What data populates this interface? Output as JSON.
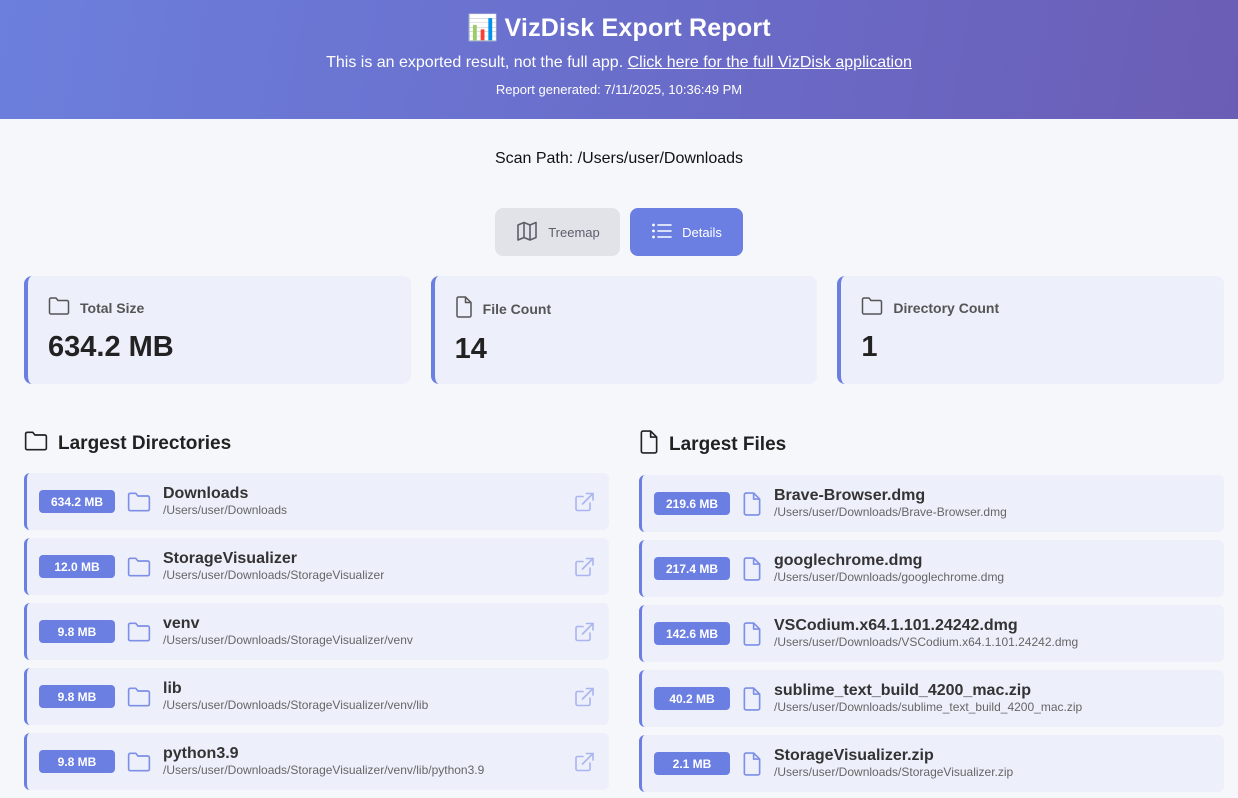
{
  "header": {
    "logo_glyph": "📊",
    "title": "VizDisk Export Report",
    "subtitle_text": "This is an exported result, not the full app.",
    "subtitle_link": "Click here for the full VizDisk application",
    "generated": "Report generated: 7/11/2025, 10:36:49 PM"
  },
  "scan_path": "Scan Path: /Users/user/Downloads",
  "view_toggle": {
    "treemap_label": "Treemap",
    "details_label": "Details",
    "active": "Details"
  },
  "stats": [
    {
      "label": "Total Size",
      "value": "634.2 MB",
      "icon": "folder-icon"
    },
    {
      "label": "File Count",
      "value": "14",
      "icon": "file-icon"
    },
    {
      "label": "Directory Count",
      "value": "1",
      "icon": "folder-icon"
    }
  ],
  "largest_directories": {
    "title": "Largest Directories",
    "items": [
      {
        "size": "634.2 MB",
        "name": "Downloads",
        "path": "/Users/user/Downloads"
      },
      {
        "size": "12.0 MB",
        "name": "StorageVisualizer",
        "path": "/Users/user/Downloads/StorageVisualizer"
      },
      {
        "size": "9.8 MB",
        "name": "venv",
        "path": "/Users/user/Downloads/StorageVisualizer/venv"
      },
      {
        "size": "9.8 MB",
        "name": "lib",
        "path": "/Users/user/Downloads/StorageVisualizer/venv/lib"
      },
      {
        "size": "9.8 MB",
        "name": "python3.9",
        "path": "/Users/user/Downloads/StorageVisualizer/venv/lib/python3.9"
      }
    ]
  },
  "largest_files": {
    "title": "Largest Files",
    "items": [
      {
        "size": "219.6 MB",
        "name": "Brave-Browser.dmg",
        "path": "/Users/user/Downloads/Brave-Browser.dmg"
      },
      {
        "size": "217.4 MB",
        "name": "googlechrome.dmg",
        "path": "/Users/user/Downloads/googlechrome.dmg"
      },
      {
        "size": "142.6 MB",
        "name": "VSCodium.x64.1.101.24242.dmg",
        "path": "/Users/user/Downloads/VSCodium.x64.1.101.24242.dmg"
      },
      {
        "size": "40.2 MB",
        "name": "sublime_text_build_4200_mac.zip",
        "path": "/Users/user/Downloads/sublime_text_build_4200_mac.zip"
      },
      {
        "size": "2.1 MB",
        "name": "StorageVisualizer.zip",
        "path": "/Users/user/Downloads/StorageVisualizer.zip"
      }
    ]
  },
  "colors": {
    "accent": "#6b7fe3",
    "card_bg": "#edeffb",
    "page_bg": "#f6f7fb",
    "header_gradient_start": "#6c7fdc",
    "header_gradient_end": "#6b5db5"
  }
}
